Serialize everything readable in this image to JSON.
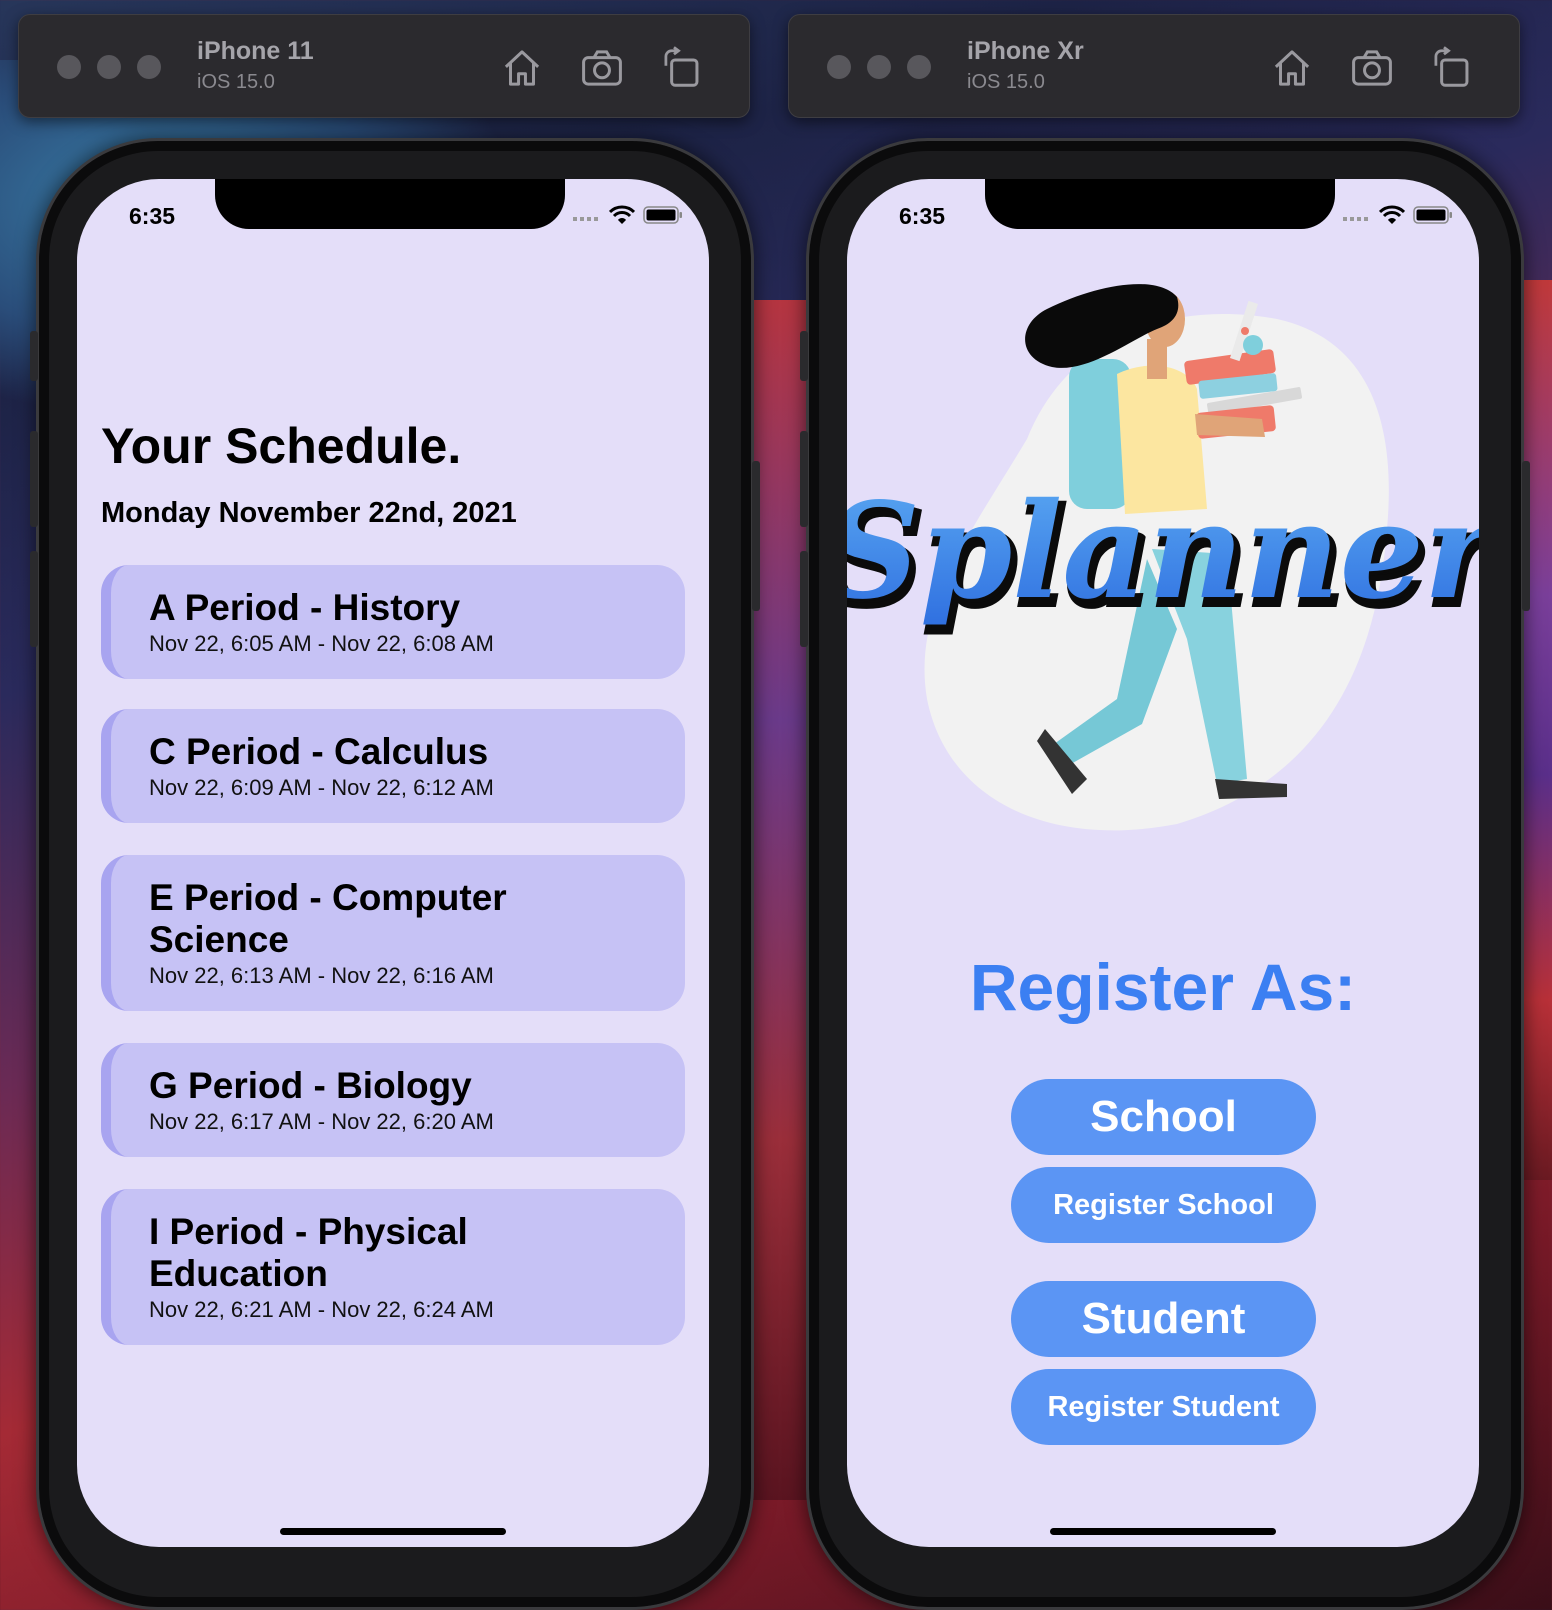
{
  "simulators": [
    {
      "device": "iPhone 11",
      "os": "iOS 15.0"
    },
    {
      "device": "iPhone Xr",
      "os": "iOS 15.0"
    }
  ],
  "toolbar_icons": [
    "home-icon",
    "screenshot-icon",
    "rotate-icon"
  ],
  "status_bar": {
    "time": "6:35"
  },
  "schedule": {
    "title": "Your Schedule.",
    "date": "Monday November 22nd, 2021",
    "periods": [
      {
        "title": "A Period - History",
        "time": "Nov 22, 6:05 AM - Nov 22, 6:08 AM"
      },
      {
        "title": "C Period - Calculus",
        "time": "Nov 22, 6:09 AM - Nov 22, 6:12 AM"
      },
      {
        "title": "E Period - Computer Science",
        "time": "Nov 22, 6:13 AM - Nov 22, 6:16 AM"
      },
      {
        "title": "G Period - Biology",
        "time": "Nov 22, 6:17 AM - Nov 22, 6:20 AM"
      },
      {
        "title": "I Period - Physical Education",
        "time": "Nov 22, 6:21 AM - Nov 22, 6:24 AM"
      }
    ]
  },
  "register": {
    "logo_text": "Splanner",
    "heading": "Register As:",
    "school_label": "School",
    "register_school_label": "Register School",
    "student_label": "Student",
    "register_student_label": "Register Student"
  },
  "colors": {
    "screen_bg": "#e4def9",
    "card_bg": "#c6c2f5",
    "accent_blue": "#3b7ff2",
    "button_blue": "#5b95f4"
  }
}
